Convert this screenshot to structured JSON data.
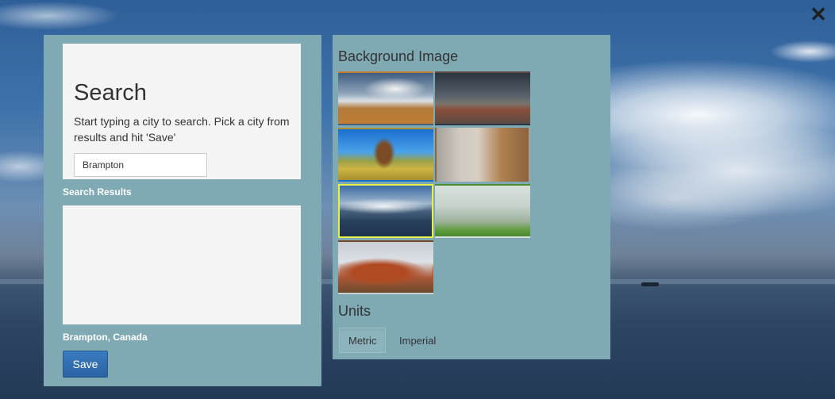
{
  "search": {
    "title": "Search",
    "help_text": "Start typing a city to search. Pick a city from results and hit 'Save'",
    "input_value": "Brampton",
    "results_label": "Search Results",
    "selected_city": "Brampton, Canada",
    "save_label": "Save"
  },
  "background": {
    "title": "Background Image",
    "thumbnails": [
      {
        "name": "clouds-over-city"
      },
      {
        "name": "cloudy-city-rooftops"
      },
      {
        "name": "desert-butte"
      },
      {
        "name": "foggy-window-field"
      },
      {
        "name": "ocean-horizon-clouds",
        "selected": true
      },
      {
        "name": "misty-forest"
      },
      {
        "name": "red-rock-formation"
      }
    ]
  },
  "units": {
    "title": "Units",
    "options": [
      "Metric",
      "Imperial"
    ],
    "selected": "Metric"
  },
  "colors": {
    "panel": "#7faab4",
    "box": "#f4f4f4",
    "save_button": "#2f6eb0",
    "selected_border": "#e6f14a"
  },
  "icons": {
    "close": "close-icon"
  }
}
